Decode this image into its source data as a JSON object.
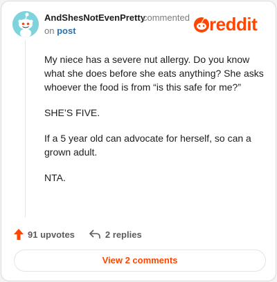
{
  "comment": {
    "username": "AndShesNotEvenPretty",
    "action": "commented",
    "on_label": "on",
    "post_label": "post",
    "body": [
      "My niece has a severe nut allergy. Do you know what she does before she eats anything? She asks whoever the food is from “is this safe for me?”",
      "SHE’S FIVE.",
      "If a 5 year old can advocate for herself, so can a grown adult.",
      "NTA."
    ],
    "upvotes": "91 upvotes",
    "replies": "2 replies",
    "view_comments": "View 2 comments"
  },
  "brand": {
    "name": "reddit",
    "accent": "#ff4500",
    "avatar_bg": "#7fd3dd"
  },
  "icons": [
    "snoo-avatar-icon",
    "reddit-logo-icon",
    "upvote-arrow-icon",
    "reply-icon"
  ]
}
